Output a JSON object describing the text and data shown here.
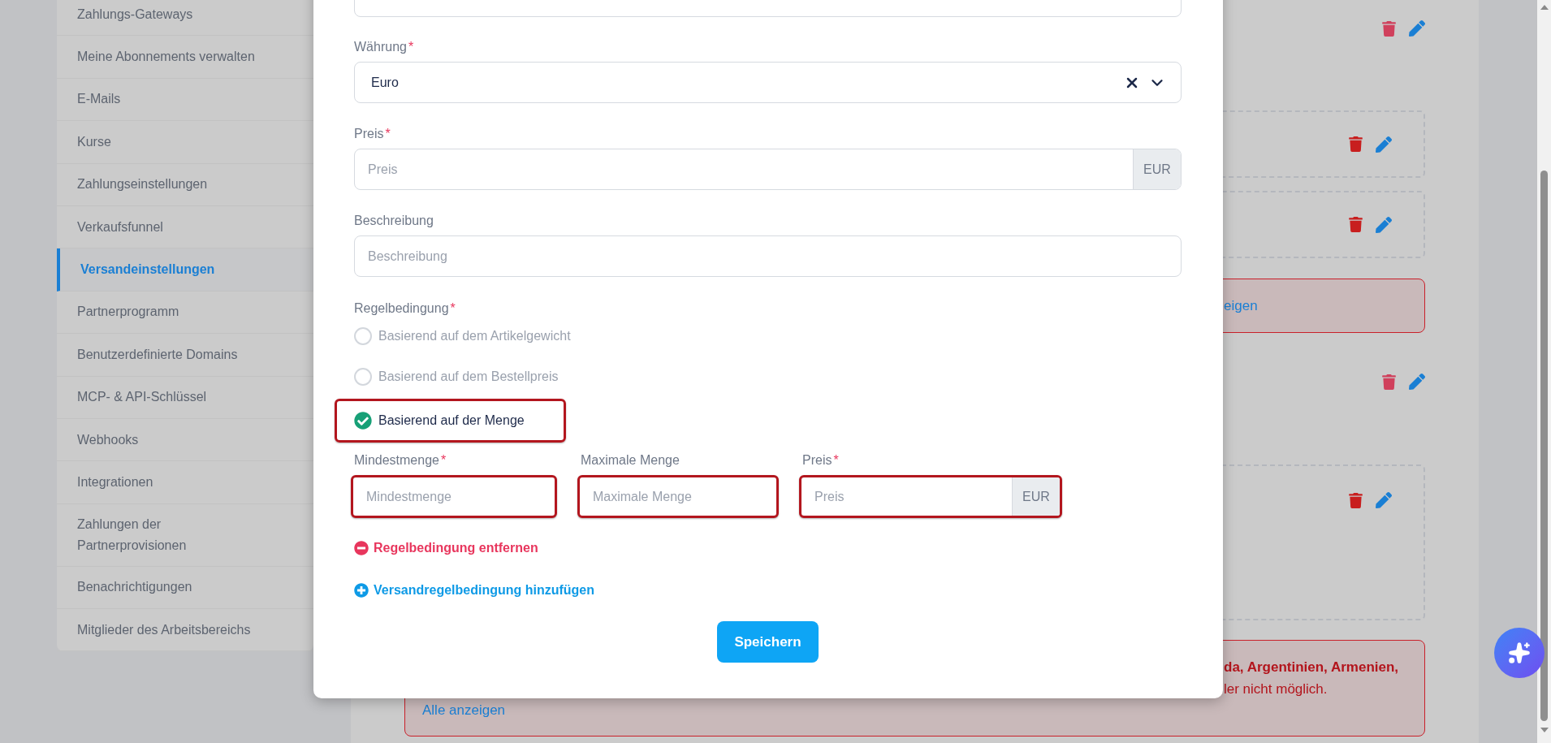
{
  "sidebar": {
    "items": [
      {
        "label": "Zahlungs-Gateways",
        "selected": false
      },
      {
        "label": "Meine Abonnements verwalten",
        "selected": false
      },
      {
        "label": "E-Mails",
        "selected": false
      },
      {
        "label": "Kurse",
        "selected": false
      },
      {
        "label": "Zahlungseinstellungen",
        "selected": false
      },
      {
        "label": "Verkaufsfunnel",
        "selected": false
      },
      {
        "label": "Versandeinstellungen",
        "selected": true
      },
      {
        "label": "Partnerprogramm",
        "selected": false
      },
      {
        "label": "Benutzerdefinierte Domains",
        "selected": false
      },
      {
        "label": "MCP- & API-Schlüssel",
        "selected": false
      },
      {
        "label": "Webhooks",
        "selected": false
      },
      {
        "label": "Integrationen",
        "selected": false
      },
      {
        "label": "Zahlungen der Partnerprovisionen",
        "selected": false
      },
      {
        "label": "Benachrichtigungen",
        "selected": false
      },
      {
        "label": "Mitglieder des Arbeitsbereichs",
        "selected": false
      }
    ]
  },
  "background": {
    "sections": [
      {
        "kind": "actions"
      },
      {
        "kind": "rule"
      },
      {
        "kind": "rule"
      },
      {
        "kind": "notice",
        "text": "eigen"
      },
      {
        "kind": "actions"
      },
      {
        "kind": "rule_large"
      },
      {
        "kind": "notice",
        "bold": "da, Argentinien, Armenien,",
        "text": "ler nicht möglich.",
        "link": "Alle anzeigen"
      }
    ]
  },
  "modal": {
    "currency": {
      "label": "Währung",
      "required_mark": "*",
      "value": "Euro"
    },
    "price": {
      "label": "Preis",
      "required_mark": "*",
      "placeholder": "Preis",
      "addon": "EUR"
    },
    "description": {
      "label": "Beschreibung",
      "placeholder": "Beschreibung"
    },
    "rule": {
      "label": "Regelbedingung",
      "required_mark": "*",
      "options": [
        {
          "label": "Basierend auf dem Artikelgewicht",
          "selected": false,
          "highlighted": false
        },
        {
          "label": "Basierend auf dem Bestellpreis",
          "selected": false,
          "highlighted": false
        },
        {
          "label": "Basierend auf der Menge",
          "selected": true,
          "highlighted": true
        }
      ]
    },
    "quantity_fields": [
      {
        "label": "Mindestmenge",
        "required_mark": "*",
        "placeholder": "Mindestmenge",
        "highlighted": true
      },
      {
        "label": "Maximale Menge",
        "placeholder": "Maximale Menge",
        "highlighted": true
      },
      {
        "label": "Preis",
        "required_mark": "*",
        "placeholder": "Preis",
        "addon": "EUR",
        "highlighted": true
      }
    ],
    "remove_link": "Regelbedingung entfernen",
    "add_link": "Versandregelbedingung hinzufügen",
    "save_button": "Speichern"
  }
}
